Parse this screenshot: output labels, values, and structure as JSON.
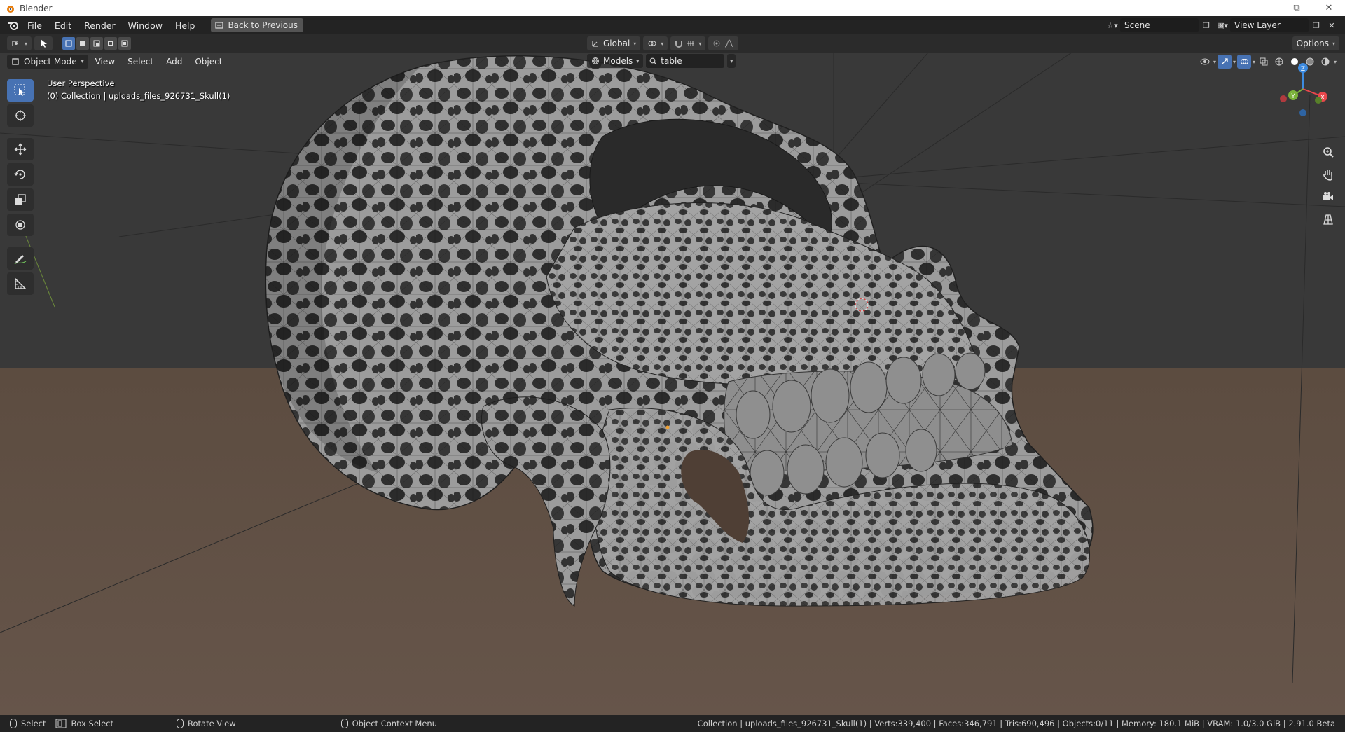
{
  "window": {
    "title": "Blender"
  },
  "menubar": {
    "items": [
      "File",
      "Edit",
      "Render",
      "Window",
      "Help"
    ],
    "back_button": "Back to Previous",
    "scene": "Scene",
    "view_layer": "View Layer"
  },
  "header": {
    "orientation": "Global",
    "options": "Options"
  },
  "viewport": {
    "mode": "Object Mode",
    "menu": [
      "View",
      "Select",
      "Add",
      "Object"
    ],
    "filter_models": "Models",
    "search_value": "table",
    "perspective_label": "User Perspective",
    "collection_label": "(0) Collection | uploads_files_926731_Skull(1)"
  },
  "gizmo": {
    "x": "X",
    "y": "Y",
    "z": "Z"
  },
  "statusbar": {
    "select": "Select",
    "box_select": "Box Select",
    "rotate_view": "Rotate View",
    "context_menu": "Object Context Menu",
    "stats": "Collection | uploads_files_926731_Skull(1) | Verts:339,400 | Faces:346,791 | Tris:690,496 | Objects:0/11 | Memory: 180.1 MiB | VRAM: 1.0/3.0 GiB | 2.91.0 Beta"
  },
  "colors": {
    "accent": "#4772b3",
    "axis_x": "#e8474c",
    "axis_y": "#7bb23a",
    "axis_z": "#3d8be0"
  }
}
